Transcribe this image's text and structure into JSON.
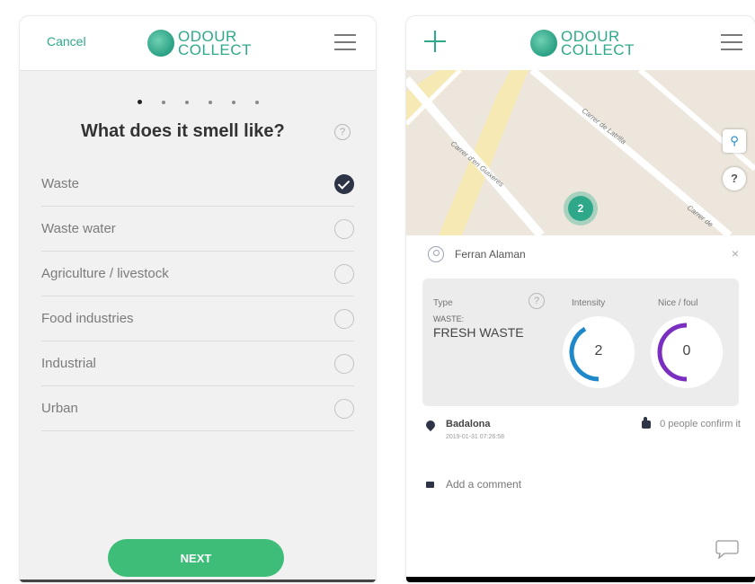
{
  "left": {
    "header": {
      "cancel_label": "Cancel",
      "logo_line1": "ODOUR",
      "logo_line2": "COLLECT"
    },
    "steps": {
      "total": 6,
      "active": 1
    },
    "question": "What does it smell like?",
    "help_glyph": "?",
    "options": [
      {
        "label": "Waste",
        "checked": true
      },
      {
        "label": "Waste water",
        "checked": false
      },
      {
        "label": "Agriculture / livestock",
        "checked": false
      },
      {
        "label": "Food industries",
        "checked": false
      },
      {
        "label": "Industrial",
        "checked": false
      },
      {
        "label": "Urban",
        "checked": false
      }
    ],
    "next_label": "NEXT"
  },
  "right": {
    "header": {
      "logo_line1": "ODOUR",
      "logo_line2": "COLLECT"
    },
    "map": {
      "streets": [
        "Carrer de Latrilla",
        "Carrer d'en Guixeres",
        "Carrer de"
      ],
      "cluster_count": "2",
      "locate_glyph": "⚲",
      "help_glyph": "?"
    },
    "card": {
      "username": "Ferran Alaman",
      "close_glyph": "×",
      "type_label": "Type",
      "type_category": "WASTE:",
      "type_value": "FRESH WASTE",
      "intensity_label": "Intensity",
      "intensity_value": 2,
      "intensity_max": 6,
      "nice_foul_label": "Nice / foul",
      "nice_foul_value": 0,
      "location": "Badalona",
      "timestamp": "2019-01-31 07:26:58",
      "confirm_text": "0 people confirm it",
      "comment_placeholder": "Add a comment"
    },
    "colors": {
      "brand": "#2ea98b",
      "next_button": "#3dbd78",
      "intensity_arc": "#1e88c8",
      "nice_foul_arc": "#7b2fc0"
    }
  }
}
